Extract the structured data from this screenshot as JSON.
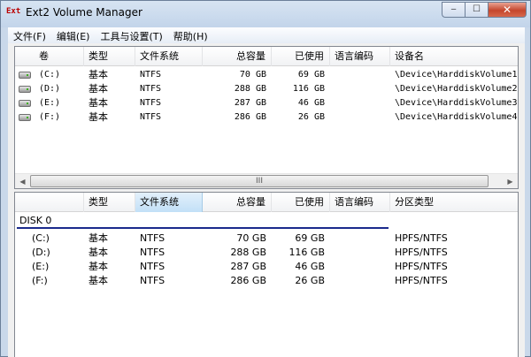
{
  "window": {
    "title": "Ext2 Volume Manager",
    "app_icon_text": "Ext",
    "minimize": "‒",
    "maximize": "☐",
    "close": "✕"
  },
  "menu": [
    {
      "label": "文件(F)"
    },
    {
      "label": "编辑(E)"
    },
    {
      "label": "工具与设置(T)"
    },
    {
      "label": "帮助(H)"
    }
  ],
  "top_list": {
    "headers": [
      "卷",
      "类型",
      "文件系统",
      "总容量",
      "已使用",
      "语言编码",
      "设备名"
    ],
    "rows": [
      {
        "volume": "(C:)",
        "type": "基本",
        "fs": "NTFS",
        "total": "70 GB",
        "used": "69 GB",
        "codepage": "",
        "device": "\\Device\\HarddiskVolume1"
      },
      {
        "volume": "(D:)",
        "type": "基本",
        "fs": "NTFS",
        "total": "288 GB",
        "used": "116 GB",
        "codepage": "",
        "device": "\\Device\\HarddiskVolume2"
      },
      {
        "volume": "(E:)",
        "type": "基本",
        "fs": "NTFS",
        "total": "287 GB",
        "used": "46 GB",
        "codepage": "",
        "device": "\\Device\\HarddiskVolume3"
      },
      {
        "volume": "(F:)",
        "type": "基本",
        "fs": "NTFS",
        "total": "286 GB",
        "used": "26 GB",
        "codepage": "",
        "device": "\\Device\\HarddiskVolume4"
      }
    ],
    "scroll_grip": "III"
  },
  "bottom_list": {
    "headers": [
      "",
      "类型",
      "文件系统",
      "总容量",
      "已使用",
      "语言编码",
      "分区类型"
    ],
    "disk_label": "DISK 0",
    "rows": [
      {
        "volume": "(C:)",
        "type": "基本",
        "fs": "NTFS",
        "total": "70 GB",
        "used": "69 GB",
        "codepage": "",
        "partition": "HPFS/NTFS"
      },
      {
        "volume": "(D:)",
        "type": "基本",
        "fs": "NTFS",
        "total": "288 GB",
        "used": "116 GB",
        "codepage": "",
        "partition": "HPFS/NTFS"
      },
      {
        "volume": "(E:)",
        "type": "基本",
        "fs": "NTFS",
        "total": "287 GB",
        "used": "46 GB",
        "codepage": "",
        "partition": "HPFS/NTFS"
      },
      {
        "volume": "(F:)",
        "type": "基本",
        "fs": "NTFS",
        "total": "286 GB",
        "used": "26 GB",
        "codepage": "",
        "partition": "HPFS/NTFS"
      }
    ]
  }
}
